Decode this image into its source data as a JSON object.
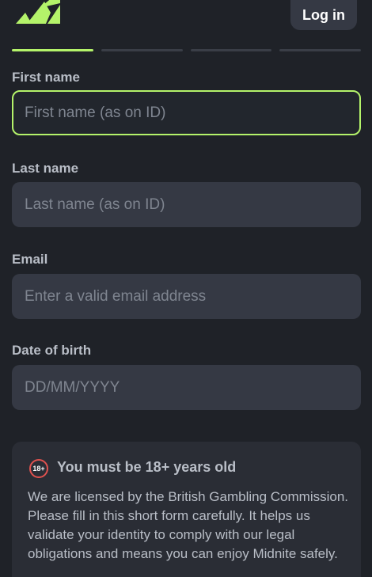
{
  "header": {
    "login_label": "Log in"
  },
  "brand": {
    "accent": "#b4f36a",
    "logo_icon": "midnite-logo-icon"
  },
  "progress": {
    "steps_total": 4,
    "steps_completed": 1
  },
  "form": {
    "first_name": {
      "label": "First name",
      "placeholder": "First name (as on ID)"
    },
    "last_name": {
      "label": "Last name",
      "placeholder": "Last name (as on ID)"
    },
    "email": {
      "label": "Email",
      "placeholder": "Enter a valid email address"
    },
    "dob": {
      "label": "Date of birth",
      "placeholder": "DD/MM/YYYY"
    }
  },
  "notice": {
    "badge": "18+",
    "title": "You must be 18+ years old",
    "body": "We are licensed by the British Gambling Commission. Please fill in this short form carefully. It helps us validate your identity to comply with our legal obligations and means you can enjoy Midnite safely."
  }
}
